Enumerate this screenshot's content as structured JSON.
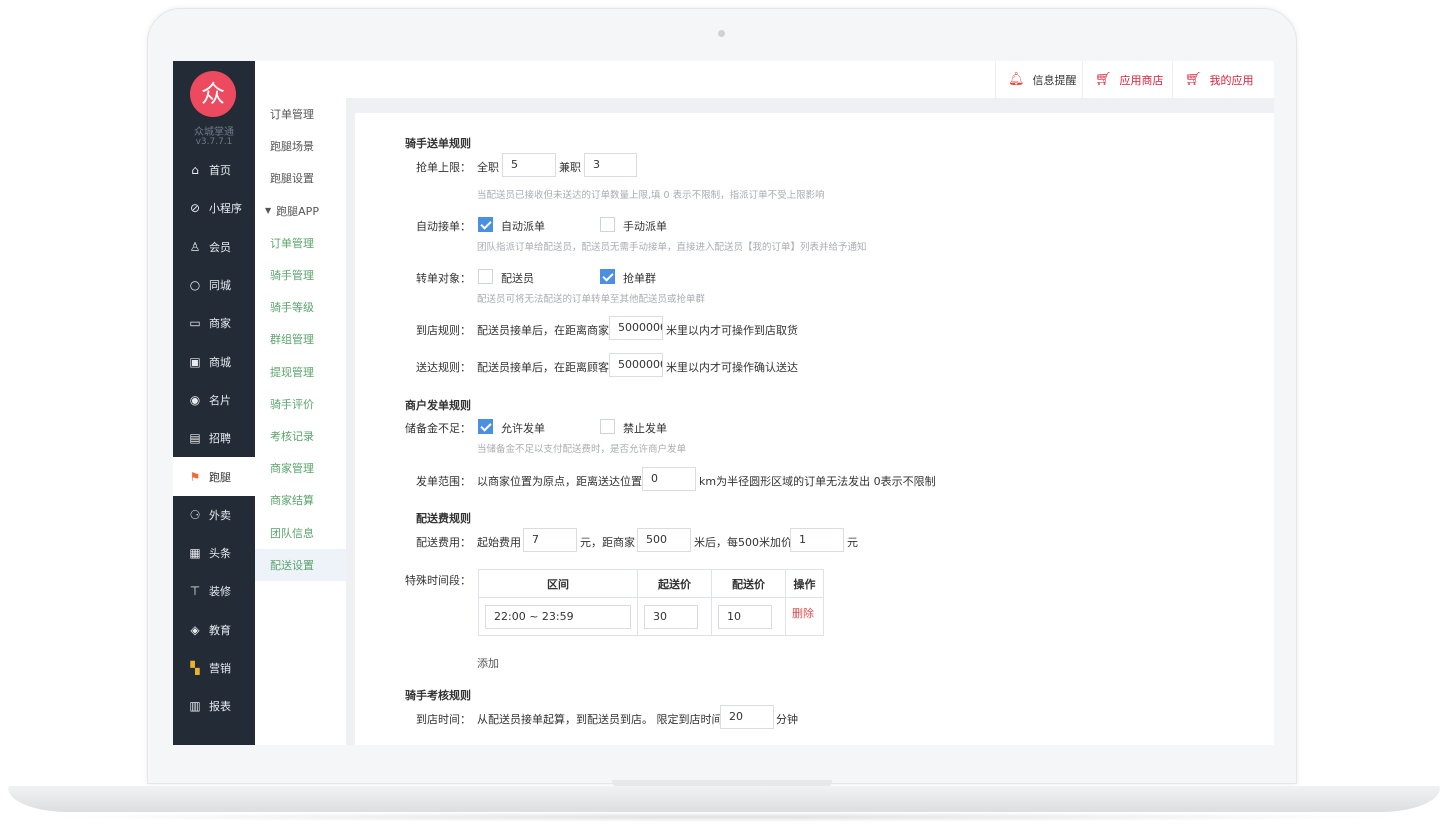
{
  "brand": {
    "logo_char": "众",
    "name": "众城掌通",
    "version": "v3.7.7.1"
  },
  "colors": {
    "sidebar": "#232b36",
    "logo": "#ee4a5f",
    "accent_green": "#5aa36b",
    "accent_red": "#d6233c",
    "checkbox": "#4a8fe2"
  },
  "sidebar": {
    "items": [
      {
        "label": "首页",
        "icon": "home-icon"
      },
      {
        "label": "小程序",
        "icon": "miniprogram-icon"
      },
      {
        "label": "会员",
        "icon": "user-icon"
      },
      {
        "label": "同城",
        "icon": "ring-icon"
      },
      {
        "label": "商家",
        "icon": "shop-icon"
      },
      {
        "label": "商城",
        "icon": "mall-icon"
      },
      {
        "label": "名片",
        "icon": "card-icon"
      },
      {
        "label": "招聘",
        "icon": "recruit-icon"
      },
      {
        "label": "跑腿",
        "icon": "runner-icon",
        "active": true
      },
      {
        "label": "外卖",
        "icon": "delivery-icon"
      },
      {
        "label": "头条",
        "icon": "news-icon"
      },
      {
        "label": "装修",
        "icon": "paint-roller-icon"
      },
      {
        "label": "教育",
        "icon": "education-icon"
      },
      {
        "label": "营销",
        "icon": "marketing-icon"
      },
      {
        "label": "报表",
        "icon": "report-icon"
      }
    ]
  },
  "subnav": {
    "top_items": [
      "订单管理",
      "跑腿场景",
      "跑腿设置"
    ],
    "group_label": "跑腿APP",
    "group_items": [
      "订单管理",
      "骑手管理",
      "骑手等级",
      "群组管理",
      "提现管理",
      "骑手评价",
      "考核记录",
      "商家管理",
      "商家结算",
      "团队信息",
      "配送设置"
    ],
    "active": "配送设置"
  },
  "topbar": {
    "notify": "信息提醒",
    "store": "应用商店",
    "my_apps": "我的应用"
  },
  "form": {
    "rider_rules_title": "骑手送单规则",
    "grab_limit": {
      "label": "抢单上限：",
      "full_label": "全职",
      "full_value": "5",
      "part_label": "兼职",
      "part_value": "3",
      "hint": "当配送员已接收但未送达的订单数量上限,填 0 表示不限制，指派订单不受上限影响"
    },
    "auto_accept": {
      "label": "自动接单：",
      "opt1": "自动派单",
      "opt1_checked": true,
      "opt2": "手动派单",
      "opt2_checked": false,
      "hint": "团队指派订单给配送员，配送员无需手动接单，直接进入配送员【我的订单】列表并给予通知"
    },
    "transfer": {
      "label": "转单对象：",
      "opt1": "配送员",
      "opt1_checked": false,
      "opt2": "抢单群",
      "opt2_checked": true,
      "hint": "配送员可将无法配送的订单转单至其他配送员或抢单群"
    },
    "arrive_rule": {
      "label": "到店规则：",
      "prefix": "配送员接单后，在距离商家",
      "value": "5000000",
      "suffix": "米里以内才可操作到店取货"
    },
    "deliver_rule": {
      "label": "送达规则：",
      "prefix": "配送员接单后，在距离顾客",
      "value": "5000000",
      "suffix": "米里以内才可操作确认送达"
    },
    "merchant_rules_title": "商户发单规则",
    "reserve": {
      "label": "储备金不足：",
      "opt1": "允许发单",
      "opt1_checked": true,
      "opt2": "禁止发单",
      "opt2_checked": false,
      "hint": "当储备金不足以支付配送费时，是否允许商户发单"
    },
    "range": {
      "label": "发单范围：",
      "prefix": "以商家位置为原点，距离送达位置",
      "value": "0",
      "suffix": "km为半径圆形区域的订单无法发出 0表示不限制"
    },
    "fee_rules_title": "配送费规则",
    "fee": {
      "label": "配送费用：",
      "start_label": "起始费用",
      "start_value": "7",
      "unit1": "元，距商家",
      "dist_value": "500",
      "unit2": "米后，每500米加价",
      "add_value": "1",
      "unit3": "元"
    },
    "special": {
      "label": "特殊时间段：",
      "headers": [
        "区间",
        "起送价",
        "配送价",
        "操作"
      ],
      "rows": [
        {
          "range": "22:00 ~ 23:59",
          "start_price": "30",
          "delivery_price": "10",
          "action": "删除"
        }
      ],
      "add_label": "添加"
    },
    "assess_title": "骑手考核规则",
    "arrive_time": {
      "label": "到店时间：",
      "prefix": "从配送员接单起算，到配送员到店。 限定到店时间",
      "value": "20",
      "suffix": "分钟"
    }
  }
}
